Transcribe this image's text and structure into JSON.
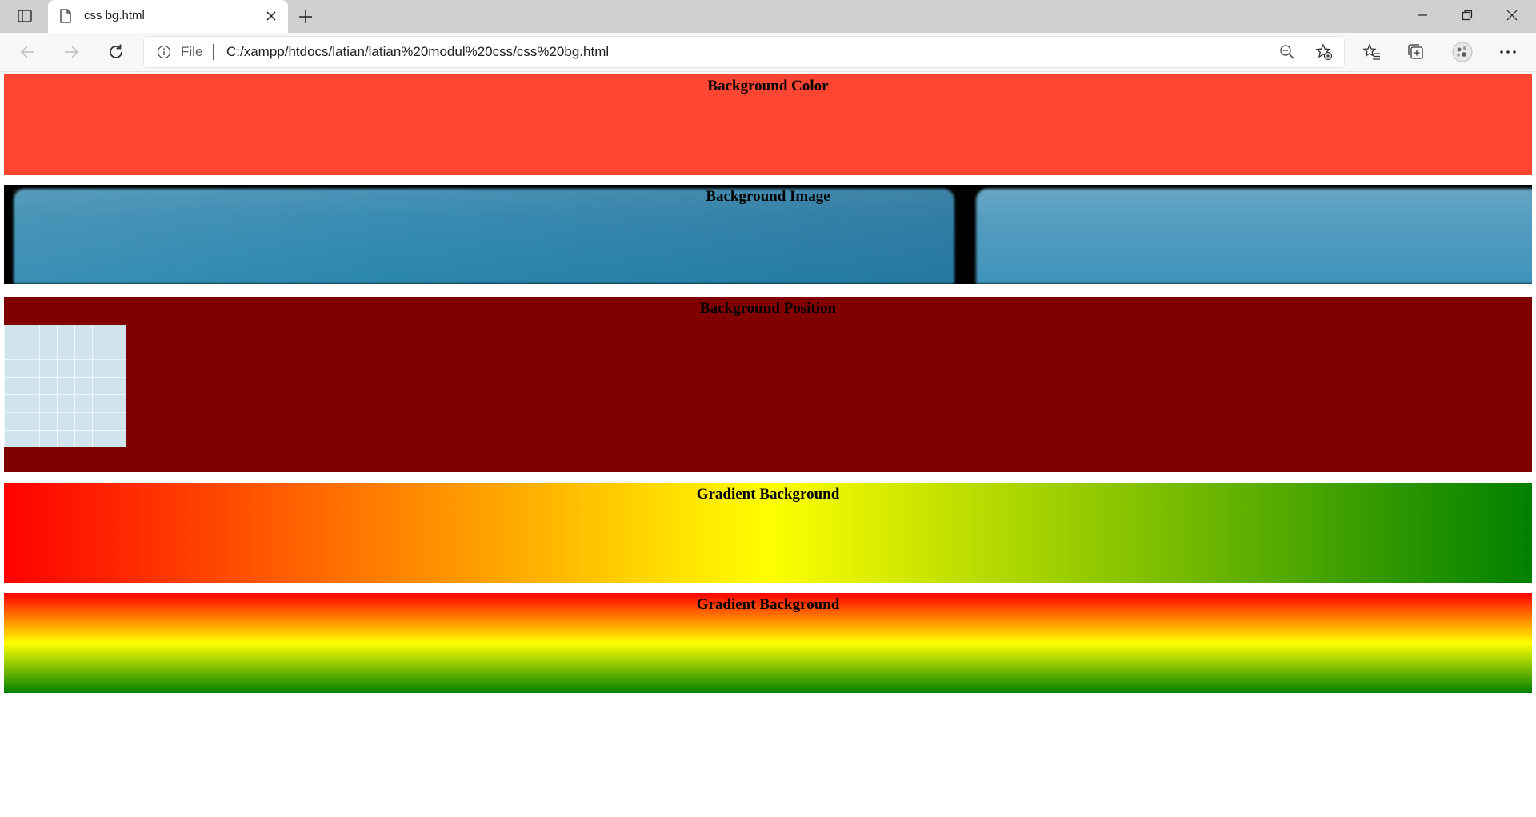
{
  "browser": {
    "tab": {
      "title": "css bg.html"
    },
    "address_bar": {
      "scheme_label": "File",
      "url": "C:/xampp/htdocs/latian/latian%20modul%20css/css%20bg.html"
    }
  },
  "page": {
    "sections": [
      {
        "heading": "Background Color",
        "background": "#ff4633"
      },
      {
        "heading": "Background Image"
      },
      {
        "heading": "Background Position",
        "background": "#800000"
      },
      {
        "heading": "Gradient Background",
        "gradient": {
          "direction": "to right",
          "colors": [
            "#ff0000",
            "#ffff00",
            "#008000"
          ]
        }
      },
      {
        "heading": "Gradient Background",
        "gradient": {
          "direction": "to bottom",
          "colors": [
            "#ff0000",
            "#ffff00",
            "#008000"
          ]
        }
      }
    ]
  },
  "colors": {
    "tabstrip_bg": "#cfcfcf",
    "toolbar_bg": "#f7f7f7",
    "icon": "#444444"
  }
}
